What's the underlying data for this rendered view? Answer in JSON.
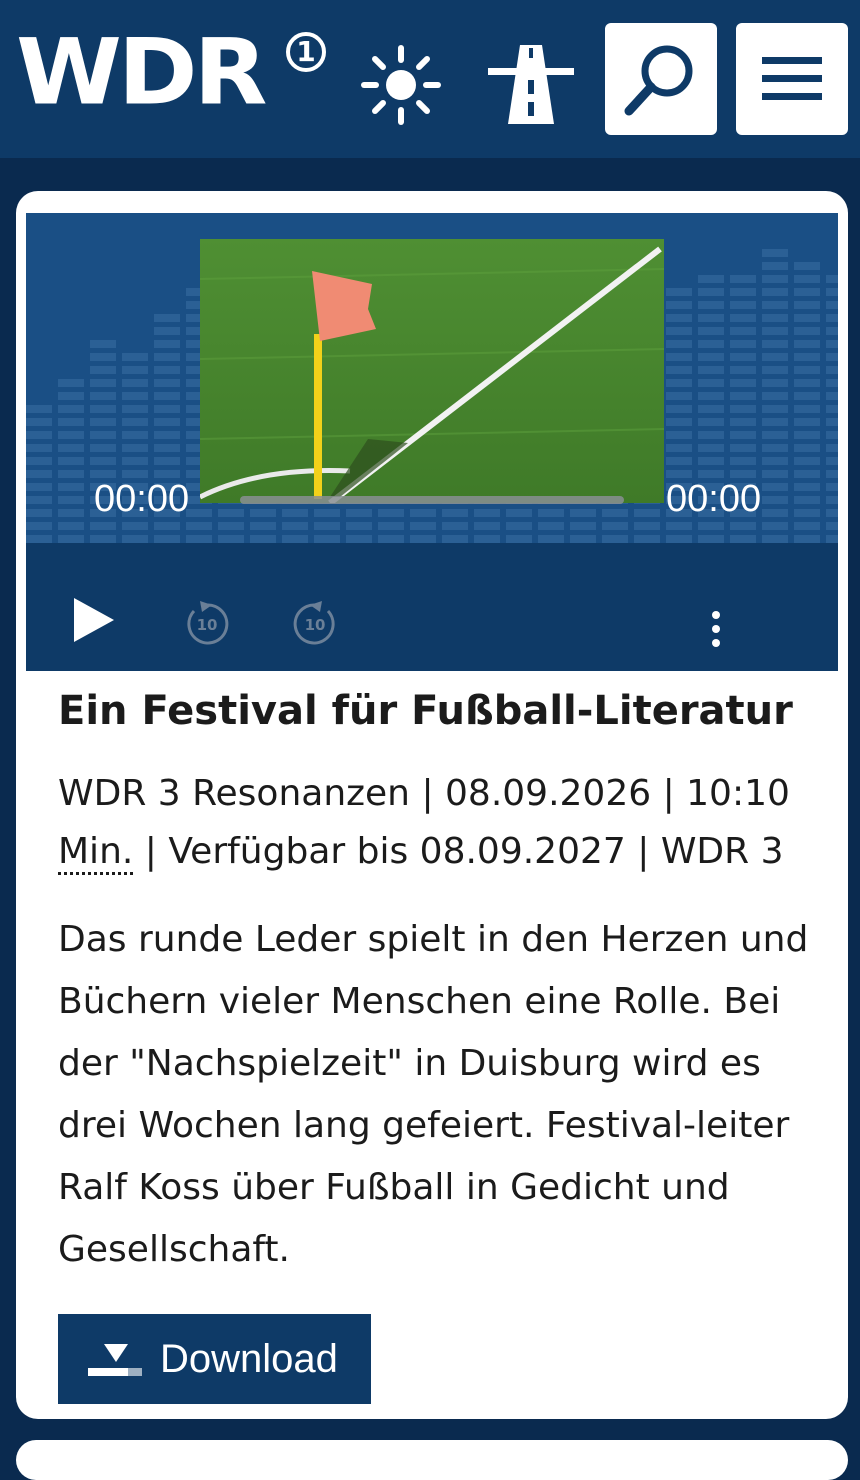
{
  "header": {
    "logo_text": "WDR",
    "logo_superscript": "1",
    "weather_icon": "sun-icon",
    "traffic_icon": "highway-icon",
    "search_icon": "search-icon",
    "menu_icon": "menu-icon"
  },
  "player": {
    "current_time": "00:00",
    "total_time": "00:00",
    "progress": 0,
    "icons": {
      "play": "play-icon",
      "rewind": "rewind-10-icon",
      "forward": "forward-10-icon",
      "more": "more-vertical-icon"
    },
    "skip_seconds": "10"
  },
  "article": {
    "title": "Ein Festival für Fußball-Literatur",
    "meta_part1": "WDR 3 Resonanzen | 08.09.2026 | 10:10",
    "meta_abbr": "Min.",
    "meta_part2": " | Verfügbar bis 08.09.2027 | WDR 3",
    "description": "Das runde Leder spielt in den Herzen und Büchern vieler Menschen eine Rolle. Bei der \"Nachspielzeit\" in Duisburg wird es drei Wochen lang gefeiert. Festival-leiter Ralf Koss über Fußball in Gedicht und Gesellschaft.",
    "download_label": "Download",
    "download_icon": "download-icon"
  },
  "colors": {
    "brand_blue": "#0e3a67",
    "background": "#0a2a4f",
    "card": "#ffffff",
    "text": "#1b1b1b"
  }
}
